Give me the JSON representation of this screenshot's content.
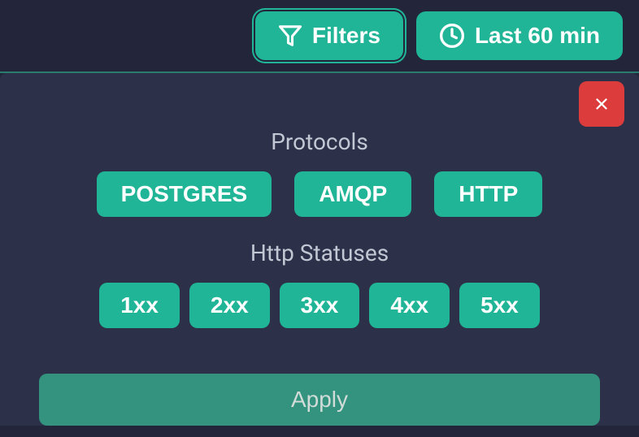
{
  "header": {
    "filters_label": "Filters",
    "timerange_label": "Last 60 min"
  },
  "panel": {
    "protocols_title": "Protocols",
    "protocols": [
      "POSTGRES",
      "AMQP",
      "HTTP"
    ],
    "http_statuses_title": "Http Statuses",
    "http_statuses": [
      "1xx",
      "2xx",
      "3xx",
      "4xx",
      "5xx"
    ],
    "apply_label": "Apply"
  },
  "colors": {
    "accent": "#1fb596",
    "danger": "#dc3c3c",
    "bg_dark": "#23263b",
    "bg_panel": "#2c3149"
  }
}
